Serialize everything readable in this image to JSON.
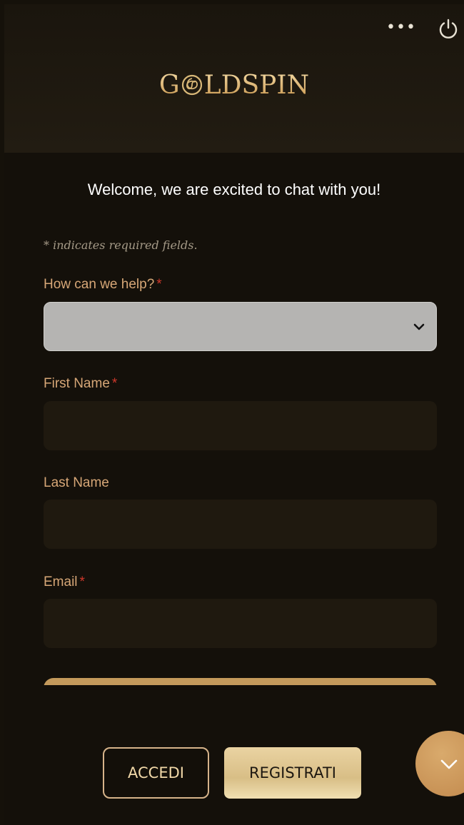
{
  "header": {
    "menu_label": "•••",
    "brand": {
      "part1": "G",
      "part2": "LD",
      "part3": "SPIN"
    }
  },
  "welcome_text": "Welcome, we are excited to chat with you!",
  "required_note": "* indicates required fields.",
  "form": {
    "help_label": "How can we help?",
    "help_value": "",
    "first_name_label": "First Name",
    "first_name_value": "",
    "last_name_label": "Last Name",
    "last_name_value": "",
    "email_label": "Email",
    "email_value": "",
    "required_marker": "*"
  },
  "footer": {
    "login_label": "ACCEDI",
    "register_label": "REGISTRATI"
  },
  "colors": {
    "accent_gold": "#d7a777",
    "required_red": "#d0382b",
    "background": "#14100a"
  },
  "icons": {
    "menu": "more-dots-icon",
    "power": "power-icon",
    "select": "chevron-down-icon",
    "scroll": "chevron-down-icon"
  }
}
